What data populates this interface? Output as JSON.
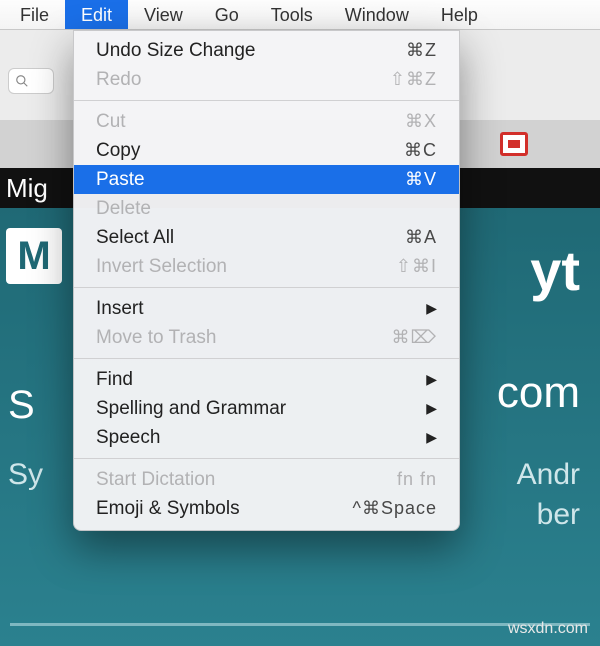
{
  "menubar": {
    "items": [
      {
        "label": "File"
      },
      {
        "label": "Edit",
        "active": true
      },
      {
        "label": "View"
      },
      {
        "label": "Go"
      },
      {
        "label": "Tools"
      },
      {
        "label": "Window"
      },
      {
        "label": "Help"
      }
    ]
  },
  "edit_menu": {
    "groups": [
      [
        {
          "label": "Undo Size Change",
          "shortcut": "⌘Z",
          "enabled": true
        },
        {
          "label": "Redo",
          "shortcut": "⇧⌘Z",
          "enabled": false
        }
      ],
      [
        {
          "label": "Cut",
          "shortcut": "⌘X",
          "enabled": false
        },
        {
          "label": "Copy",
          "shortcut": "⌘C",
          "enabled": true
        },
        {
          "label": "Paste",
          "shortcut": "⌘V",
          "enabled": true,
          "highlight": true
        },
        {
          "label": "Delete",
          "shortcut": "",
          "enabled": false
        },
        {
          "label": "Select All",
          "shortcut": "⌘A",
          "enabled": true
        },
        {
          "label": "Invert Selection",
          "shortcut": "⇧⌘I",
          "enabled": false
        }
      ],
      [
        {
          "label": "Insert",
          "submenu": true,
          "enabled": true
        },
        {
          "label": "Move to Trash",
          "shortcut": "⌘⌦",
          "enabled": false
        }
      ],
      [
        {
          "label": "Find",
          "submenu": true,
          "enabled": true
        },
        {
          "label": "Spelling and Grammar",
          "submenu": true,
          "enabled": true
        },
        {
          "label": "Speech",
          "submenu": true,
          "enabled": true
        }
      ],
      [
        {
          "label": "Start Dictation",
          "shortcut": "fn fn",
          "enabled": false
        },
        {
          "label": "Emoji & Symbols",
          "shortcut": "^⌘Space",
          "enabled": true
        }
      ]
    ]
  },
  "backdrop": {
    "black_strip_text": "Mig",
    "teal_text_1": "yt",
    "teal_text_2": "com",
    "teal_text_3": "Andr",
    "teal_text_4": "ber",
    "left_text_1": "S",
    "left_text_2": "Sy"
  },
  "watermark": "wsxdn.com",
  "swatch_red": "#d22f2a"
}
